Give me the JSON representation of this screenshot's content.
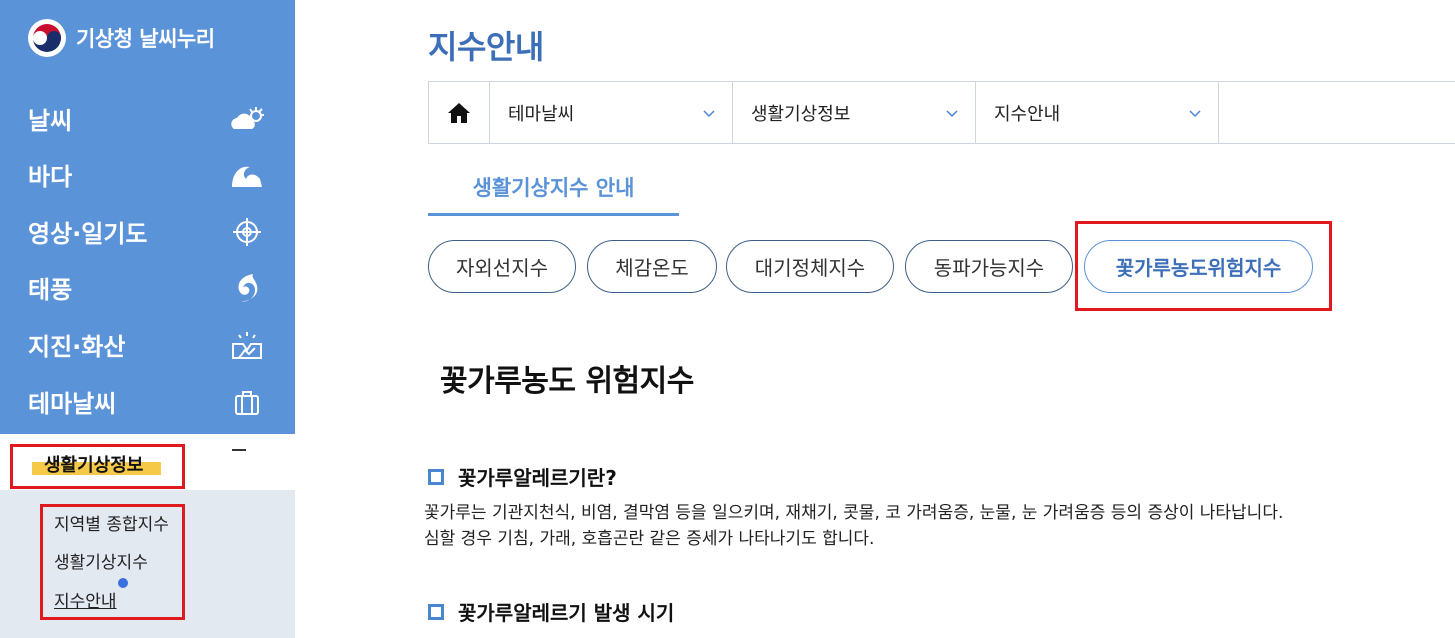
{
  "sidebar": {
    "logo_text": "기상청 날씨누리",
    "items": [
      {
        "label": "날씨",
        "icon": "cloud-sun-icon"
      },
      {
        "label": "바다",
        "icon": "wave-icon"
      },
      {
        "label": "영상·일기도",
        "icon": "target-icon"
      },
      {
        "label": "태풍",
        "icon": "typhoon-icon"
      },
      {
        "label": "지진·화산",
        "icon": "earthquake-icon"
      },
      {
        "label": "테마날씨",
        "icon": "briefcase-icon"
      }
    ],
    "active_section": "생활기상정보",
    "collapse_symbol": "minus-icon",
    "subitems": [
      {
        "label": "지역별 종합지수"
      },
      {
        "label": "생활기상지수"
      },
      {
        "label": "지수안내"
      }
    ]
  },
  "main": {
    "page_title": "지수안내",
    "breadcrumb": {
      "home_icon": "home-icon",
      "selects": [
        "테마날씨",
        "생활기상정보",
        "지수안내"
      ]
    },
    "tab_label": "생활기상지수 안내",
    "pills": [
      "자외선지수",
      "체감온도",
      "대기정체지수",
      "동파가능지수",
      "꽃가루농도위험지수"
    ],
    "active_pill": "꽃가루농도위험지수",
    "section_title": "꽃가루농도 위험지수",
    "subsections": [
      {
        "heading": "꽃가루알레르기란?",
        "lines": [
          "꽃가루는 기관지천식, 비염, 결막염 등을 일으키며, 재채기, 콧물, 코 가려움증, 눈물, 눈 가려움증 등의 증상이 나타납니다.",
          "심할 경우 기침, 가래, 호흡곤란 같은 증세가 나타나기도 합니다."
        ]
      },
      {
        "heading": "꽃가루알레르기 발생 시기"
      }
    ]
  },
  "colors": {
    "sidebar": "#5b93d8",
    "accent": "#3d6fb8",
    "highlight": "#f7c948",
    "annotation_box": "#e0191f"
  }
}
